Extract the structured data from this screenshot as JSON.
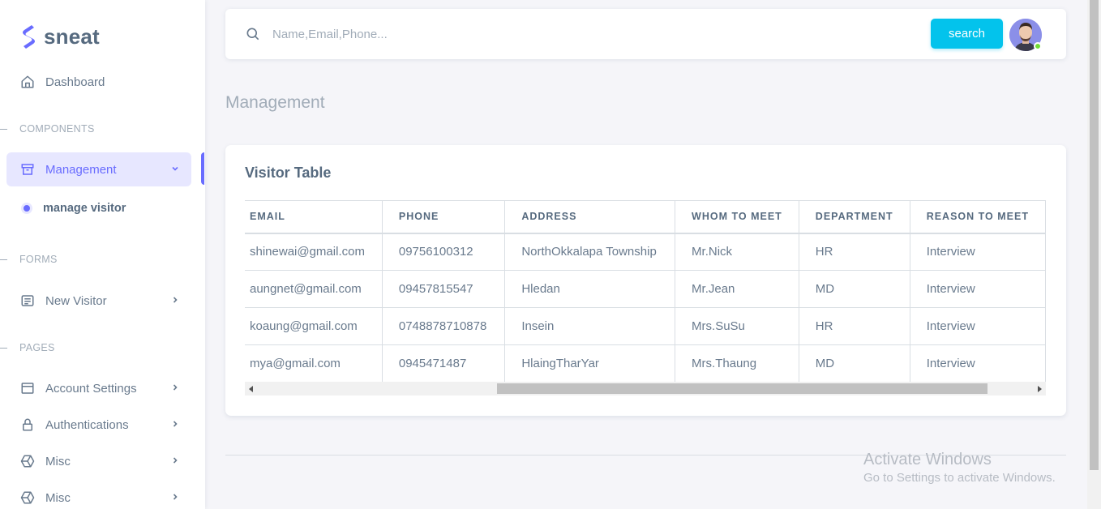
{
  "brand": {
    "name": "sneat",
    "color": "#696cff"
  },
  "sidebar": {
    "dashboard": {
      "label": "Dashboard",
      "icon": "home-icon"
    },
    "sections": {
      "components": "COMPONENTS",
      "forms": "FORMS",
      "pages": "PAGES"
    },
    "management": {
      "label": "Management",
      "icon": "archive-icon"
    },
    "manage_visitor": "manage visitor",
    "new_visitor": {
      "label": "New Visitor",
      "icon": "form-icon"
    },
    "account_settings": {
      "label": "Account Settings",
      "icon": "window-icon"
    },
    "authentications": {
      "label": "Authentications",
      "icon": "lock-icon"
    },
    "misc1": {
      "label": "Misc",
      "icon": "cube-icon"
    },
    "misc2": {
      "label": "Misc",
      "icon": "cube-icon"
    }
  },
  "navbar": {
    "search_placeholder": "Name,Email,Phone...",
    "search_button": "search",
    "button_color": "#03c3ec"
  },
  "page_title": "Management",
  "card": {
    "title": "Visitor Table",
    "columns": [
      "EMAIL",
      "PHONE",
      "ADDRESS",
      "WHOM TO MEET",
      "DEPARTMENT",
      "REASON TO MEET"
    ],
    "rows": [
      [
        "shinewai@gmail.com",
        "09756100312",
        "NorthOkkalapa Township",
        "Mr.Nick",
        "HR",
        "Interview"
      ],
      [
        "aungnet@gmail.com",
        "09457815547",
        "Hledan",
        "Mr.Jean",
        "MD",
        "Interview"
      ],
      [
        "koaung@gmail.com",
        "0748878710878",
        "Insein",
        "Mrs.SuSu",
        "HR",
        "Interview"
      ],
      [
        "mya@gmail.com",
        "0945471487",
        "HlaingTharYar",
        "Mrs.Thaung",
        "MD",
        "Interview"
      ]
    ]
  },
  "watermark": {
    "title": "Activate Windows",
    "subtitle": "Go to Settings to activate Windows."
  }
}
